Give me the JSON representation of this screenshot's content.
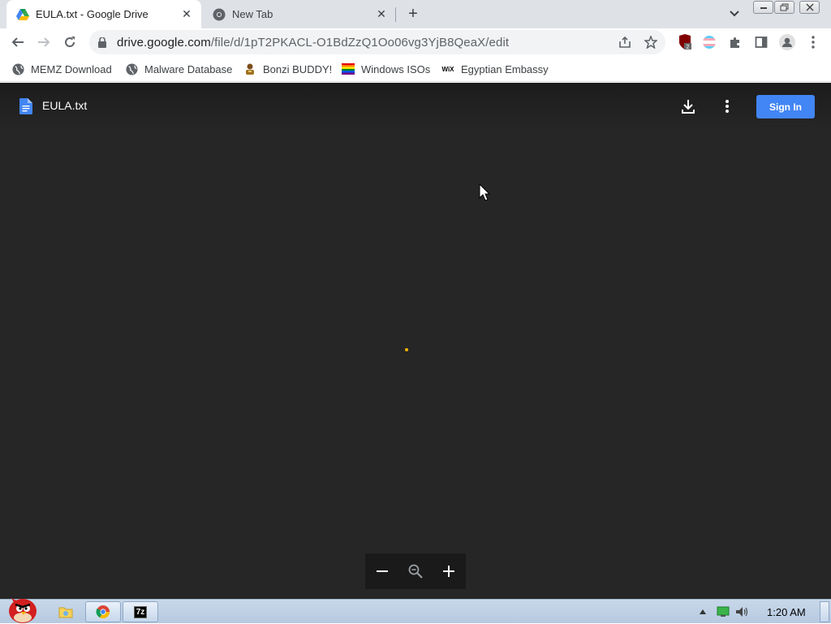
{
  "browser": {
    "tabs": [
      {
        "title": "EULA.txt - Google Drive",
        "active": true,
        "favicon": "google-drive-icon"
      },
      {
        "title": "New Tab",
        "active": false,
        "favicon": "chrome-icon"
      }
    ],
    "new_tab": "+",
    "address_bar": {
      "domain": "drive.google.com",
      "path": "/file/d/1pT2PKACL-O1BdZzQ1Oo06vg3YjB8QeaX/edit"
    },
    "extensions_badge": "2",
    "bookmarks": [
      {
        "label": "MEMZ Download",
        "icon": "globe-icon"
      },
      {
        "label": "Malware Database",
        "icon": "globe-icon"
      },
      {
        "label": "Bonzi BUDDY!",
        "icon": "bonzi-icon"
      },
      {
        "label": "Windows ISOs",
        "icon": "rainbow-flag-icon"
      },
      {
        "label": "Egyptian Embassy",
        "icon": "wix-icon"
      }
    ]
  },
  "viewer": {
    "file_name": "EULA.txt",
    "sign_in_label": "Sign In"
  },
  "taskbar": {
    "clock": "1:20 AM",
    "chrome_tab_label": "7z"
  },
  "colors": {
    "viewer_bg": "#262626",
    "sign_in_bg": "#4285f4",
    "spinner": "#f4b400"
  }
}
